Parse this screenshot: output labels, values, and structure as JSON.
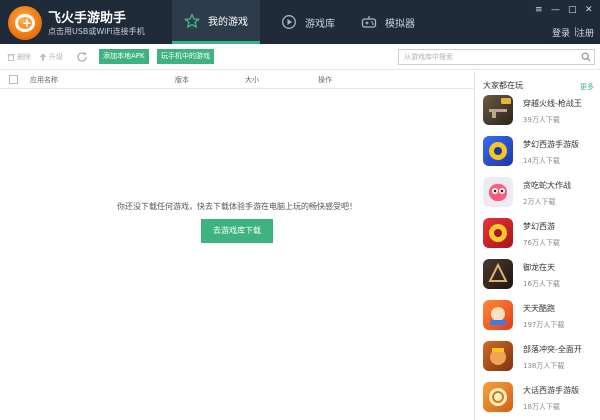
{
  "app": {
    "title": "飞火手游助手",
    "subtitle": "点击用USB或WiFi连接手机"
  },
  "tabs": [
    {
      "label": "我的游戏",
      "icon": "star-icon",
      "active": true
    },
    {
      "label": "游戏库",
      "icon": "game-library-icon",
      "active": false
    },
    {
      "label": "模拟器",
      "icon": "gamepad-icon",
      "active": false
    }
  ],
  "window": {
    "menu_glyph": "≡",
    "minimize_glyph": "—",
    "maximize_glyph": "□",
    "close_glyph": "✕",
    "login": "登录",
    "register": "注册"
  },
  "toolbar": {
    "delete_label": "删除",
    "upgrade_label": "升级",
    "add_local_apk": "添加本地APK",
    "games_on_phone": "玩手机中的游戏",
    "search_placeholder": "从游戏库中搜索"
  },
  "table": {
    "columns": [
      "应用名称",
      "版本",
      "大小",
      "操作"
    ]
  },
  "empty": {
    "message": "你还没下载任何游戏，快去下载体验手游在电脑上玩的畅快感受吧！",
    "button": "去游戏库下载"
  },
  "sidebar": {
    "title": "大家都在玩",
    "more": "更多",
    "games": [
      {
        "name": "穿越火线-枪战王",
        "downloads": "39万人下载",
        "icon": "cf-game-icon",
        "color": "#4a3a2a"
      },
      {
        "name": "梦幻西游手游版",
        "downloads": "14万人下载",
        "icon": "menghuan-game-icon",
        "color": "#2a4fd0"
      },
      {
        "name": "贪吃蛇大作战",
        "downloads": "2万人下载",
        "icon": "snake-game-icon",
        "color": "#e9e9ee"
      },
      {
        "name": "梦幻西游",
        "downloads": "76万人下载",
        "icon": "menghuan-classic-icon",
        "color": "#d8252c"
      },
      {
        "name": "御龙在天",
        "downloads": "16万人下载",
        "icon": "yulong-game-icon",
        "color": "#3b2a22"
      },
      {
        "name": "天天酷跑",
        "downloads": "197万人下载",
        "icon": "kupao-game-icon",
        "color": "#ff6a1f"
      },
      {
        "name": "部落冲突-全面开",
        "downloads": "138万人下载",
        "icon": "clash-game-icon",
        "color": "#b5581d"
      },
      {
        "name": "大话西游手游版",
        "downloads": "18万人下载",
        "icon": "dahua-game-icon",
        "color": "#f08a20"
      }
    ]
  },
  "colors": {
    "titlebar": "#1f2b38",
    "accent": "#3fb37f"
  }
}
